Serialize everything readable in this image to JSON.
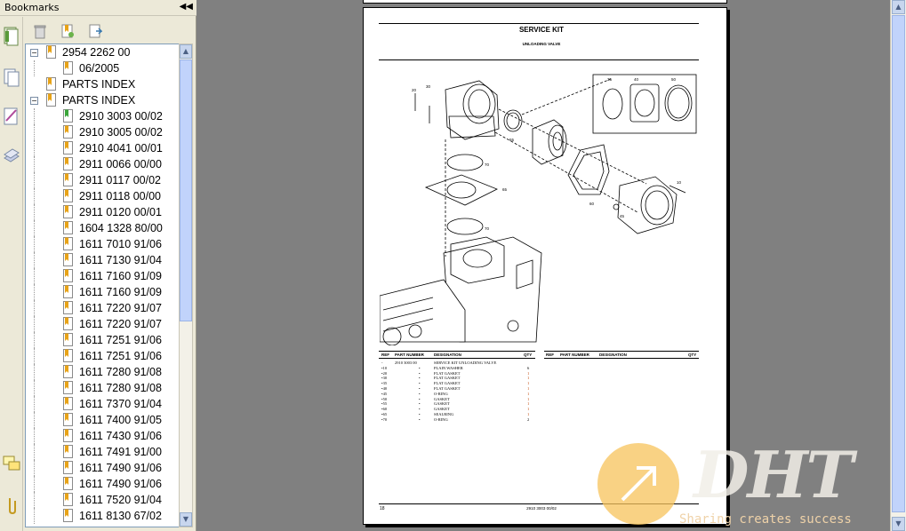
{
  "panel": {
    "title": "Bookmarks",
    "collapse_glyph": "◀◀",
    "side_tabs": [
      "pages-icon",
      "layers-icon",
      "signatures-icon",
      "attachments-icon",
      "comments-icon",
      "paperclip-icon"
    ],
    "toolbar": [
      "delete-bookmark-icon",
      "new-bookmark-icon",
      "expand-bookmark-icon"
    ]
  },
  "bookmarks": [
    {
      "label": "2954 2262 00",
      "level": 0,
      "toggle": "−"
    },
    {
      "label": "06/2005",
      "level": 1,
      "toggle": ""
    },
    {
      "label": "PARTS INDEX",
      "level": 0,
      "toggle": ""
    },
    {
      "label": "PARTS INDEX",
      "level": 0,
      "toggle": "−"
    },
    {
      "label": "2910 3003 00/02",
      "level": 1,
      "toggle": "",
      "active": true
    },
    {
      "label": "2910 3005 00/02",
      "level": 1,
      "toggle": ""
    },
    {
      "label": "2910 4041 00/01",
      "level": 1,
      "toggle": ""
    },
    {
      "label": "2911 0066 00/00",
      "level": 1,
      "toggle": ""
    },
    {
      "label": "2911 0117 00/02",
      "level": 1,
      "toggle": ""
    },
    {
      "label": "2911 0118 00/00",
      "level": 1,
      "toggle": ""
    },
    {
      "label": "2911 0120 00/01",
      "level": 1,
      "toggle": ""
    },
    {
      "label": "1604 1328 80/00",
      "level": 1,
      "toggle": ""
    },
    {
      "label": "1611 7010 91/06",
      "level": 1,
      "toggle": ""
    },
    {
      "label": "1611 7130 91/04",
      "level": 1,
      "toggle": ""
    },
    {
      "label": "1611 7160 91/09",
      "level": 1,
      "toggle": ""
    },
    {
      "label": "1611 7160 91/09",
      "level": 1,
      "toggle": ""
    },
    {
      "label": "1611 7220 91/07",
      "level": 1,
      "toggle": ""
    },
    {
      "label": "1611 7220 91/07",
      "level": 1,
      "toggle": ""
    },
    {
      "label": "1611 7251 91/06",
      "level": 1,
      "toggle": ""
    },
    {
      "label": "1611 7251 91/06",
      "level": 1,
      "toggle": ""
    },
    {
      "label": "1611 7280 91/08",
      "level": 1,
      "toggle": ""
    },
    {
      "label": "1611 7280 91/08",
      "level": 1,
      "toggle": ""
    },
    {
      "label": "1611 7370 91/04",
      "level": 1,
      "toggle": ""
    },
    {
      "label": "1611 7400 91/05",
      "level": 1,
      "toggle": ""
    },
    {
      "label": "1611 7430 91/06",
      "level": 1,
      "toggle": ""
    },
    {
      "label": "1611 7491 91/00",
      "level": 1,
      "toggle": ""
    },
    {
      "label": "1611 7490 91/06",
      "level": 1,
      "toggle": ""
    },
    {
      "label": "1611 7490 91/06",
      "level": 1,
      "toggle": ""
    },
    {
      "label": "1611 7520 91/04",
      "level": 1,
      "toggle": ""
    },
    {
      "label": "1611 8130 67/02",
      "level": 1,
      "toggle": ""
    }
  ],
  "document": {
    "title": "SERVICE KIT",
    "subtitle": "UNLOADING VALVE",
    "table_headers_left": [
      "REF",
      "PART NUMBER",
      "DESIGNATION",
      "QTY"
    ],
    "table_headers_right": [
      "REF",
      "PART NUMBER",
      "DESIGNATION",
      "QTY"
    ],
    "rows": [
      {
        "ref": "-",
        "part": "2910 3003 00",
        "desig": "SERVICE KIT UNLOADING VALVE",
        "qty": ""
      },
      {
        "ref": "•10",
        "part": "•",
        "desig": "PLAIN WASHER",
        "qty": "6"
      },
      {
        "ref": "•20",
        "part": "•",
        "desig": "FLAT GASKET",
        "qty": "1"
      },
      {
        "ref": "•30",
        "part": "•",
        "desig": "FLAT GASKET",
        "qty": "1"
      },
      {
        "ref": "•35",
        "part": "•",
        "desig": "FLAT GASKET",
        "qty": "1"
      },
      {
        "ref": "•40",
        "part": "•",
        "desig": "FLAT GASKET",
        "qty": "1"
      },
      {
        "ref": "•45",
        "part": "•",
        "desig": "O-RING",
        "qty": "1"
      },
      {
        "ref": "•50",
        "part": "•",
        "desig": "GASKET",
        "qty": "1"
      },
      {
        "ref": "•55",
        "part": "•",
        "desig": "GASKET",
        "qty": "1"
      },
      {
        "ref": "•60",
        "part": "•",
        "desig": "GASKET",
        "qty": "1"
      },
      {
        "ref": "•65",
        "part": "•",
        "desig": "SEALRING",
        "qty": "1"
      },
      {
        "ref": "•70",
        "part": "•",
        "desig": "O-RING",
        "qty": "2"
      }
    ],
    "callouts": [
      "20",
      "30",
      "35",
      "40",
      "50",
      "55",
      "60",
      "45",
      "10",
      "65",
      "70",
      "70"
    ],
    "footer_left": "18",
    "footer_center": "2910 3003 00/02"
  },
  "watermark": {
    "brand": "DHT",
    "tagline": "Sharing creates success"
  },
  "colors": {
    "panel_bg": "#ece9d8",
    "doc_bg": "#808080",
    "scroll_thumb": "#c1d3fb",
    "bookmark_icon": "#e8a317",
    "active_bookmark_icon": "#3aa63a",
    "watermark_orange": "#f7c35b"
  }
}
